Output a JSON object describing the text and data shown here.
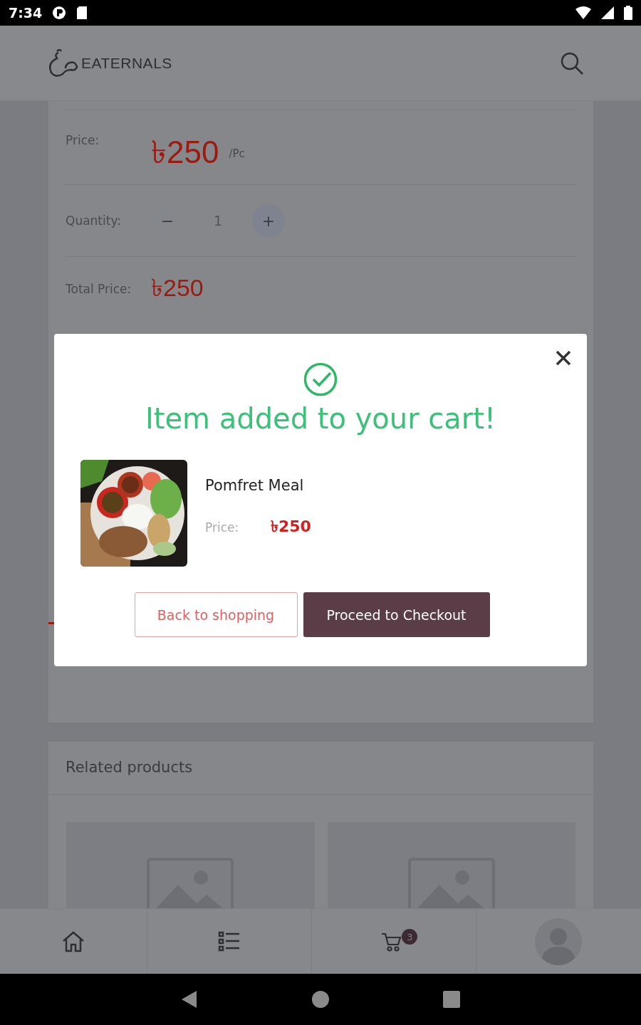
{
  "status_bar": {
    "time": "7:34"
  },
  "app_bar": {
    "logo": "EATERNALS"
  },
  "product": {
    "price_label": "Price:",
    "price": "৳250",
    "unit": "/Pc",
    "quantity_label": "Quantity:",
    "decrement": "−",
    "quantity": "1",
    "increment": "+",
    "total_label": "Total Price:",
    "total": "৳250"
  },
  "modal": {
    "title": "Item added to your cart!",
    "item": {
      "name": "Pomfret Meal",
      "price_label": "Price:",
      "price": "৳250"
    },
    "buttons": [
      {
        "label": "Back to shopping",
        "kind": "outline"
      },
      {
        "label": "Proceed to Checkout",
        "kind": "primary"
      }
    ]
  },
  "related": {
    "title": "Related products",
    "items": [
      {
        "kind": "placeholder"
      },
      {
        "kind": "placeholder"
      }
    ]
  },
  "bottom_nav": {
    "items": [
      {
        "kind": "home"
      },
      {
        "kind": "list"
      },
      {
        "kind": "cart",
        "badge": "3"
      },
      {
        "kind": "profile"
      }
    ]
  }
}
